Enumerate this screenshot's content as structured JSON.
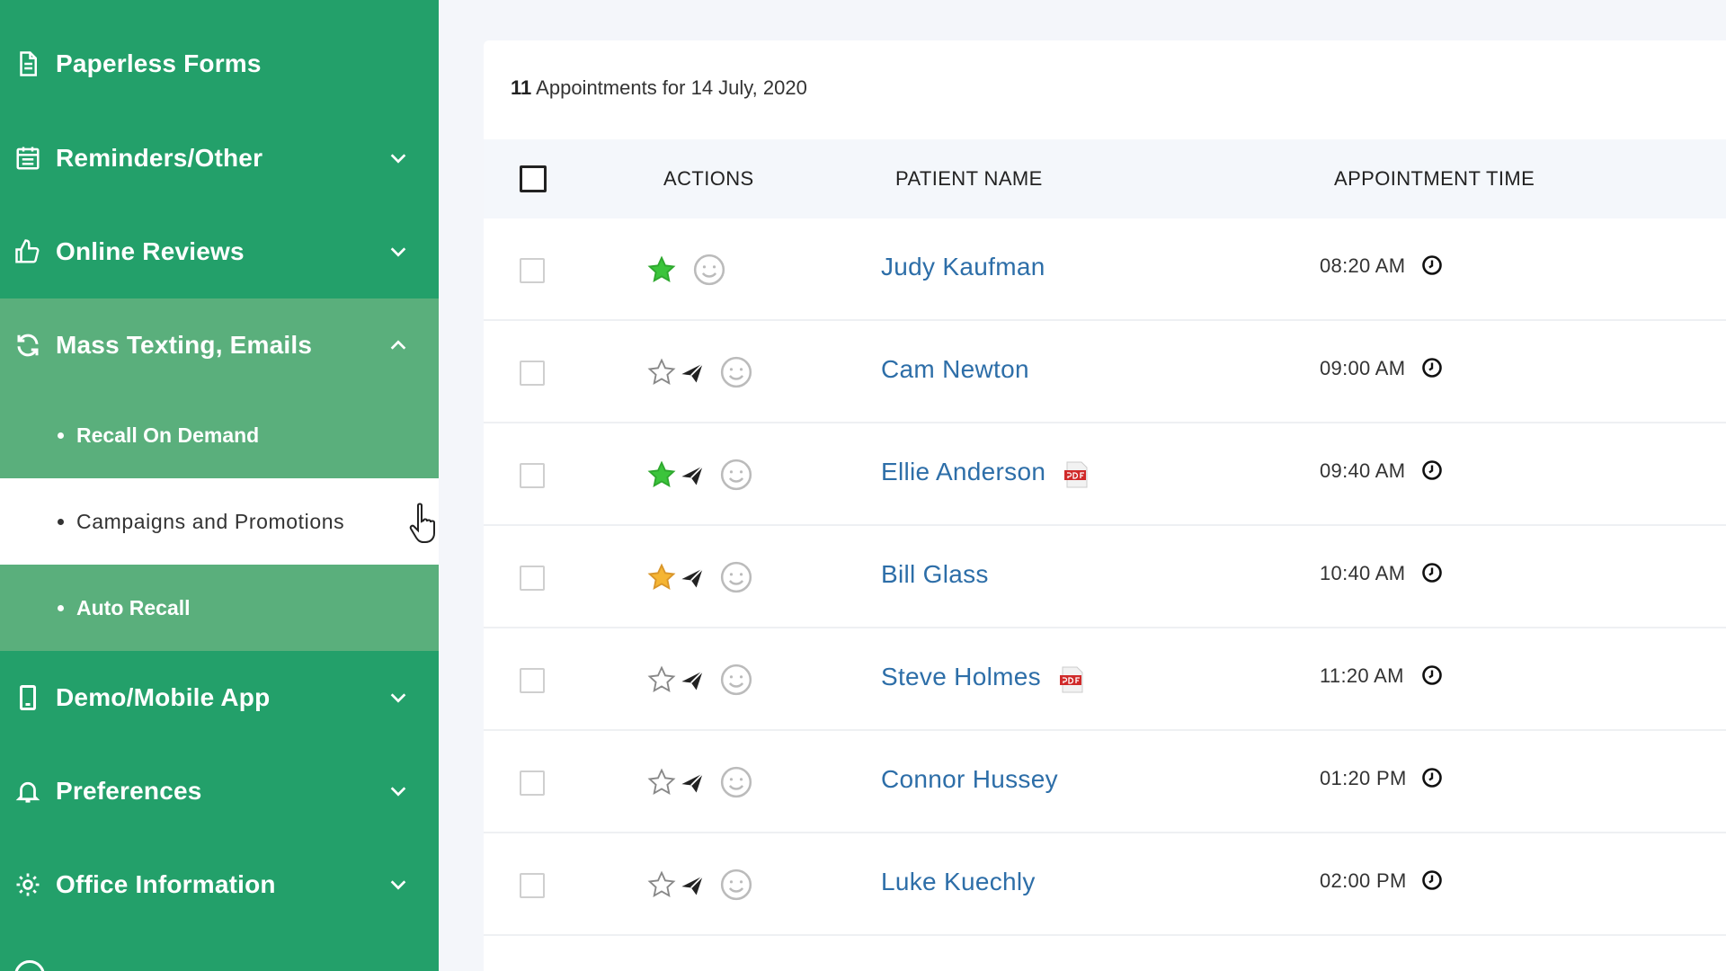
{
  "sidebar": {
    "items": [
      {
        "label": "Paperless Forms",
        "icon": "document-icon"
      },
      {
        "label": "Reminders/Other",
        "icon": "list-icon"
      },
      {
        "label": "Online Reviews",
        "icon": "thumbs-up-icon"
      },
      {
        "label": "Mass Texting, Emails",
        "icon": "refresh-icon"
      },
      {
        "label": "Demo/Mobile App",
        "icon": "mobile-icon"
      },
      {
        "label": "Preferences",
        "icon": "bell-icon"
      },
      {
        "label": "Office Information",
        "icon": "gear-icon"
      }
    ],
    "subitems": [
      {
        "label": "Recall On Demand"
      },
      {
        "label": "Campaigns and Promotions"
      },
      {
        "label": "Auto Recall"
      }
    ]
  },
  "summary": {
    "count": "11",
    "text": "Appointments for 14 July, 2020"
  },
  "table": {
    "headers": {
      "actions": "ACTIONS",
      "patient": "PATIENT NAME",
      "time": "APPOINTMENT TIME"
    },
    "rows": [
      {
        "name": "Judy Kaufman",
        "time": "08:20 AM",
        "star": "green",
        "sent": false,
        "pdf": false
      },
      {
        "name": "Cam Newton",
        "time": "09:00 AM",
        "star": "empty",
        "sent": true,
        "pdf": false
      },
      {
        "name": "Ellie Anderson",
        "time": "09:40 AM",
        "star": "green",
        "sent": true,
        "pdf": true
      },
      {
        "name": "Bill Glass",
        "time": "10:40 AM",
        "star": "gold",
        "sent": true,
        "pdf": false
      },
      {
        "name": "Steve Holmes",
        "time": "11:20 AM",
        "star": "empty",
        "sent": true,
        "pdf": true
      },
      {
        "name": "Connor Hussey",
        "time": "01:20 PM",
        "star": "empty",
        "sent": true,
        "pdf": false
      },
      {
        "name": "Luke Kuechly",
        "time": "02:00 PM",
        "star": "empty",
        "sent": true,
        "pdf": false
      }
    ]
  },
  "colors": {
    "sidebar": "#23a06a",
    "submenu": "#5aaf7c",
    "link": "#2d6ea8",
    "star_green": "#3bc43b",
    "star_gold": "#f5b533"
  }
}
